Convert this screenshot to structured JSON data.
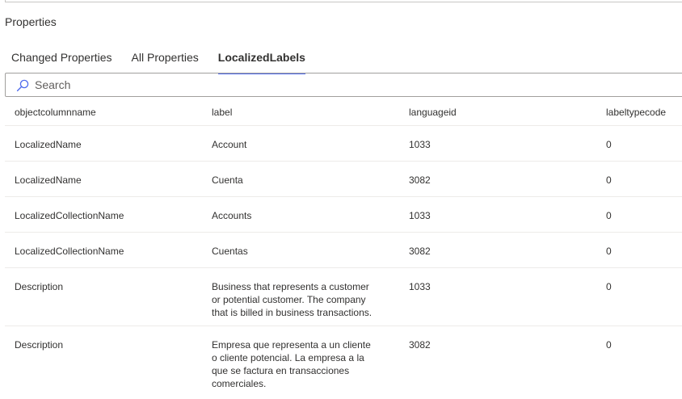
{
  "panel": {
    "title": "Properties"
  },
  "tabs": [
    {
      "label": "Changed Properties",
      "active": false
    },
    {
      "label": "All Properties",
      "active": false
    },
    {
      "label": "LocalizedLabels",
      "active": true
    }
  ],
  "accent_color": "#4f6bed",
  "search": {
    "placeholder": "Search",
    "icon": "search-icon"
  },
  "table": {
    "columns": [
      "objectcolumnname",
      "label",
      "languageid",
      "labeltypecode"
    ],
    "rows": [
      {
        "objectcolumnname": "LocalizedName",
        "label": "Account",
        "languageid": "1033",
        "labeltypecode": "0"
      },
      {
        "objectcolumnname": "LocalizedName",
        "label": "Cuenta",
        "languageid": "3082",
        "labeltypecode": "0"
      },
      {
        "objectcolumnname": "LocalizedCollectionName",
        "label": "Accounts",
        "languageid": "1033",
        "labeltypecode": "0"
      },
      {
        "objectcolumnname": "LocalizedCollectionName",
        "label": "Cuentas",
        "languageid": "3082",
        "labeltypecode": "0"
      },
      {
        "objectcolumnname": "Description",
        "label": "Business that represents a customer or potential customer. The company that is billed in business transactions.",
        "languageid": "1033",
        "labeltypecode": "0"
      },
      {
        "objectcolumnname": "Description",
        "label": "Empresa que representa a un cliente o cliente potencial. La empresa a la que se factura en transacciones comerciales.",
        "languageid": "3082",
        "labeltypecode": "0"
      }
    ]
  }
}
